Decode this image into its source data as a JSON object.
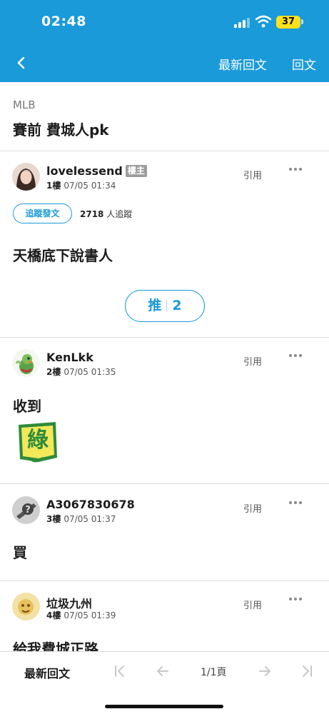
{
  "status_bar": {
    "time": "02:48",
    "battery": "37"
  },
  "nav": {
    "latest_label": "最新回文",
    "reply_label": "回文"
  },
  "thread": {
    "board": "MLB",
    "title": "賽前 費城人pk"
  },
  "posts": [
    {
      "author": "lovelessend",
      "op_tag": "樓主",
      "floor": "1樓",
      "time": "07/05 01:34",
      "quote_label": "引用",
      "follow_label": "追蹤發文",
      "follow_count": "2718",
      "follow_suffix": "人追蹤",
      "body": "天橋底下說書人",
      "push_label": "推",
      "push_count": "2"
    },
    {
      "author": "KenLkk",
      "floor": "2樓",
      "time": "07/05 01:35",
      "quote_label": "引用",
      "body": "收到",
      "sticker_text": "綠"
    },
    {
      "author": "A3067830678",
      "floor": "3樓",
      "time": "07/05 01:37",
      "quote_label": "引用",
      "body": "買"
    },
    {
      "author": "垃圾九州",
      "floor": "4樓",
      "time": "07/05 01:39",
      "quote_label": "引用",
      "body": "給我費城正路"
    }
  ],
  "bottom_bar": {
    "latest_label": "最新回文",
    "page_label": "1/1頁"
  },
  "colors": {
    "accent": "#1a9ad9",
    "battery": "#ffe11c"
  }
}
